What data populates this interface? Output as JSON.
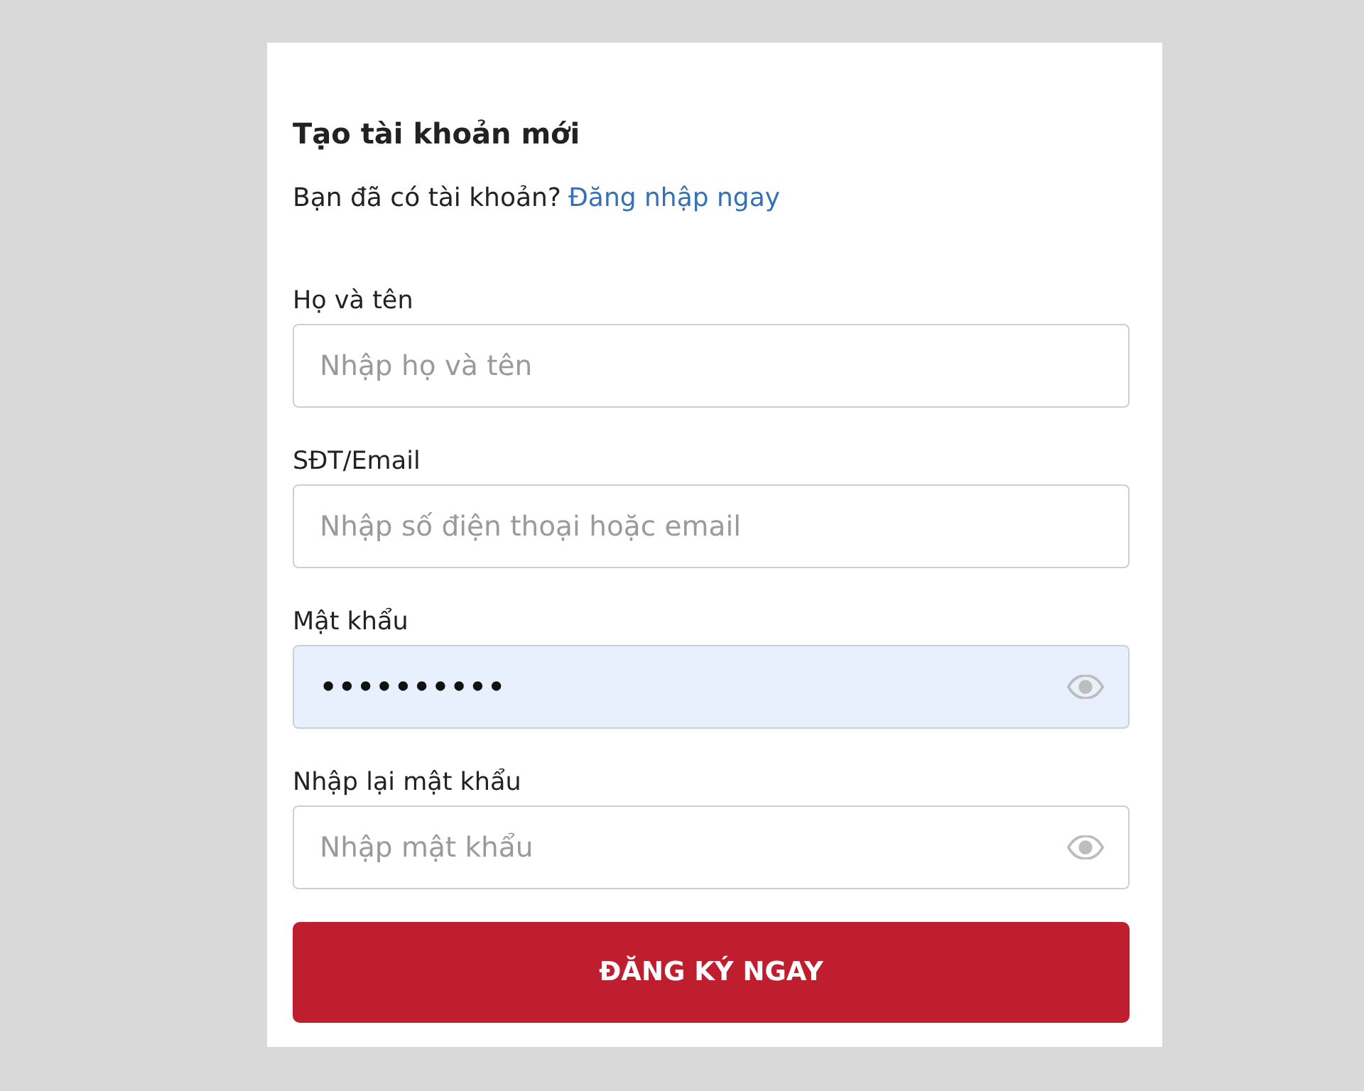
{
  "form": {
    "title": "Tạo tài khoản mới",
    "prompt": "Bạn đã có tài khoản?",
    "login_link": "Đăng nhập ngay",
    "fields": [
      {
        "kind": "text",
        "label": "Họ và tên",
        "placeholder": "Nhập họ và tên",
        "autofilled": false
      },
      {
        "kind": "text",
        "label": "SĐT/Email",
        "placeholder": "Nhập số điện thoại hoặc email",
        "autofilled": false
      },
      {
        "kind": "password",
        "label": "Mật khẩu",
        "value": "••••••••••",
        "autofilled": true
      },
      {
        "kind": "password",
        "label": "Nhập lại mật khẩu",
        "placeholder": "Nhập mật khẩu",
        "autofilled": false
      }
    ],
    "submit_button": "ĐĂNG KÝ NGAY"
  }
}
